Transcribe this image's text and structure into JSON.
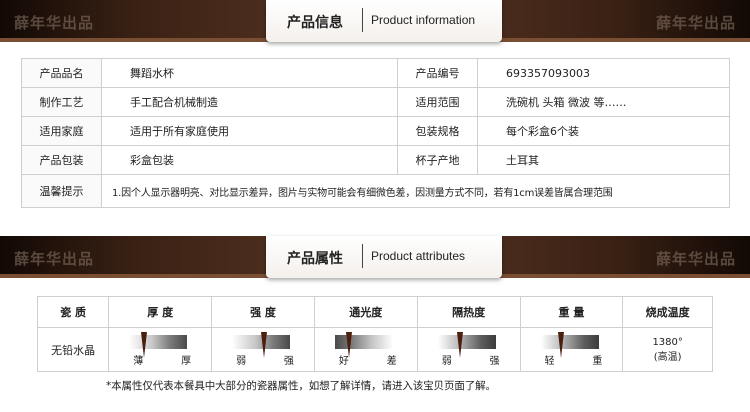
{
  "watermark": "薛年华出品",
  "info_header": {
    "cn": "产品信息",
    "en": "Product information"
  },
  "info": {
    "rows": [
      {
        "k1": "产品品名",
        "v1": "舞蹈水杯",
        "k2": "产品编号",
        "v2": "693357093003"
      },
      {
        "k1": "制作工艺",
        "v1": "手工配合机械制造",
        "k2": "适用范围",
        "v2": "洗碗机  头箱  微波  等……"
      },
      {
        "k1": "适用家庭",
        "v1": "适用于所有家庭使用",
        "k2": "包装规格",
        "v2": "每个彩盒6个装"
      },
      {
        "k1": "产品包装",
        "v1": "彩盒包装",
        "k2": "杯子产地",
        "v2": "土耳其"
      }
    ],
    "note_label": "温馨提示",
    "note": "1.因个人显示器明亮、对比显示差异，图片与实物可能会有细微色差，因测量方式不同，若有1cm误差皆属合理范围"
  },
  "attr_header": {
    "cn": "产品属性",
    "en": "Product attributes"
  },
  "attrs": {
    "headers": [
      "瓷  质",
      "厚  度",
      "强  度",
      "通光度",
      "隔热度",
      "重  量",
      "烧成温度"
    ],
    "material": "无铅水晶",
    "scales": [
      {
        "lo": "薄",
        "hi": "厚",
        "level": 0.25
      },
      {
        "lo": "弱",
        "hi": "强",
        "level": 0.55
      },
      {
        "lo": "好",
        "hi": "差",
        "level": 0.25
      },
      {
        "lo": "弱",
        "hi": "强",
        "level": 0.38
      },
      {
        "lo": "轻",
        "hi": "重",
        "level": 0.35
      }
    ],
    "temp": "1380°",
    "temp_note": "(高温)"
  },
  "footer": "*本属性仅代表本餐具中大部分的瓷器属性，如想了解详情，请进入该宝贝页面了解。"
}
